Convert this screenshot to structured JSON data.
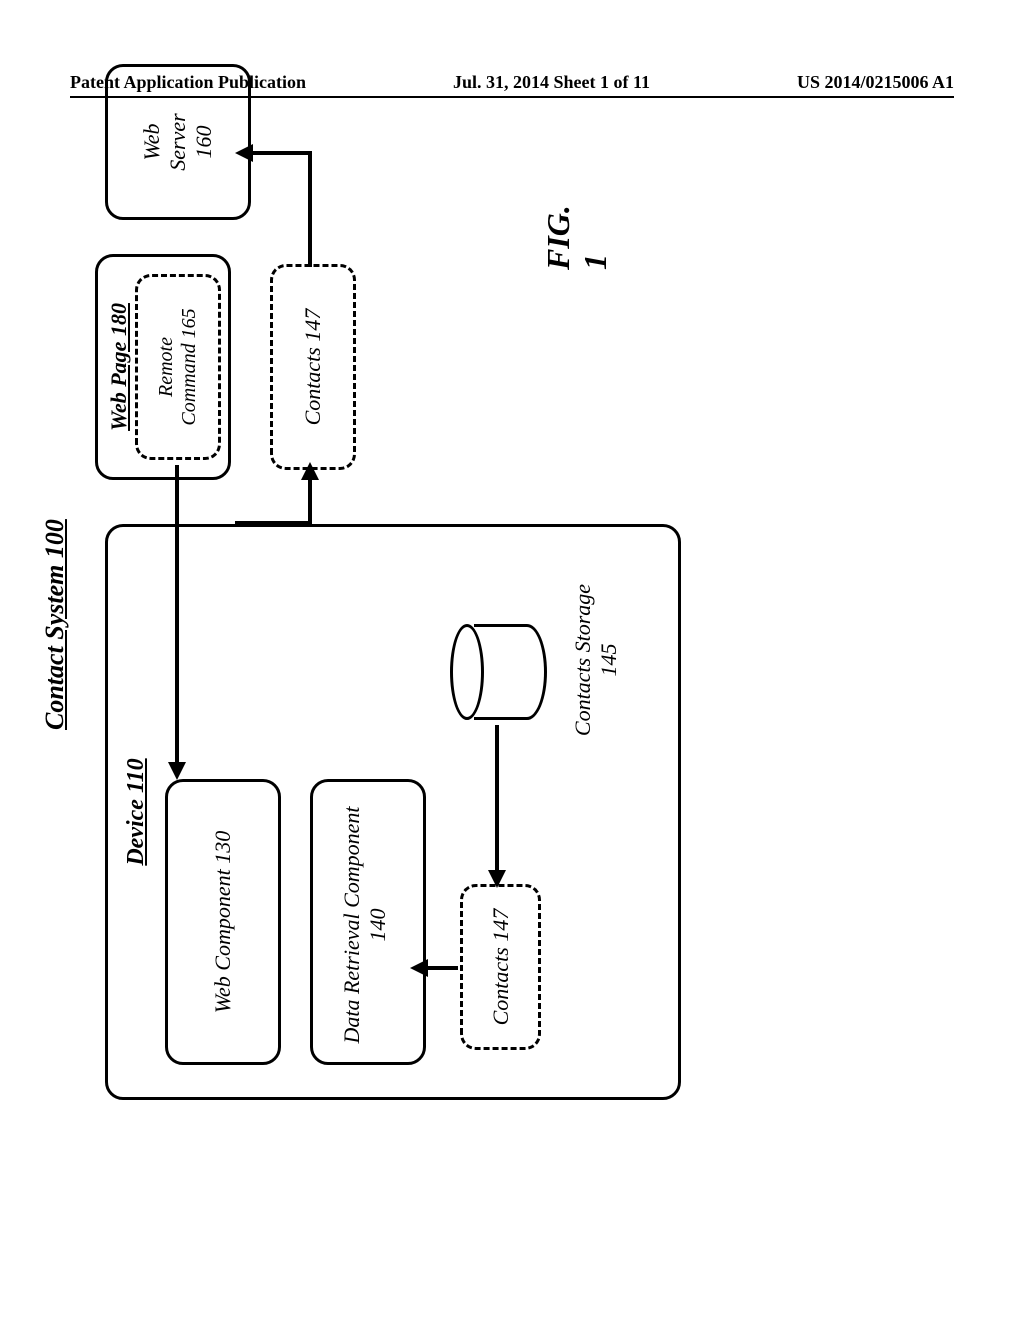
{
  "header": {
    "left": "Patent Application Publication",
    "center": "Jul. 31, 2014   Sheet 1 of 11",
    "right": "US 2014/0215006 A1"
  },
  "system_title": "Contact System 100",
  "figure_label": "FIG. 1",
  "device": {
    "label": "Device 110",
    "web_component": "Web Component 130",
    "data_retrieval": "Data Retrieval Component 140",
    "contacts_147_a": "Contacts 147",
    "contacts_storage": "Contacts Storage 145"
  },
  "web_page": {
    "label": "Web Page 180",
    "remote_command": "Remote Command 165"
  },
  "contacts_147_b": "Contacts 147",
  "web_server": "Web Server 160"
}
